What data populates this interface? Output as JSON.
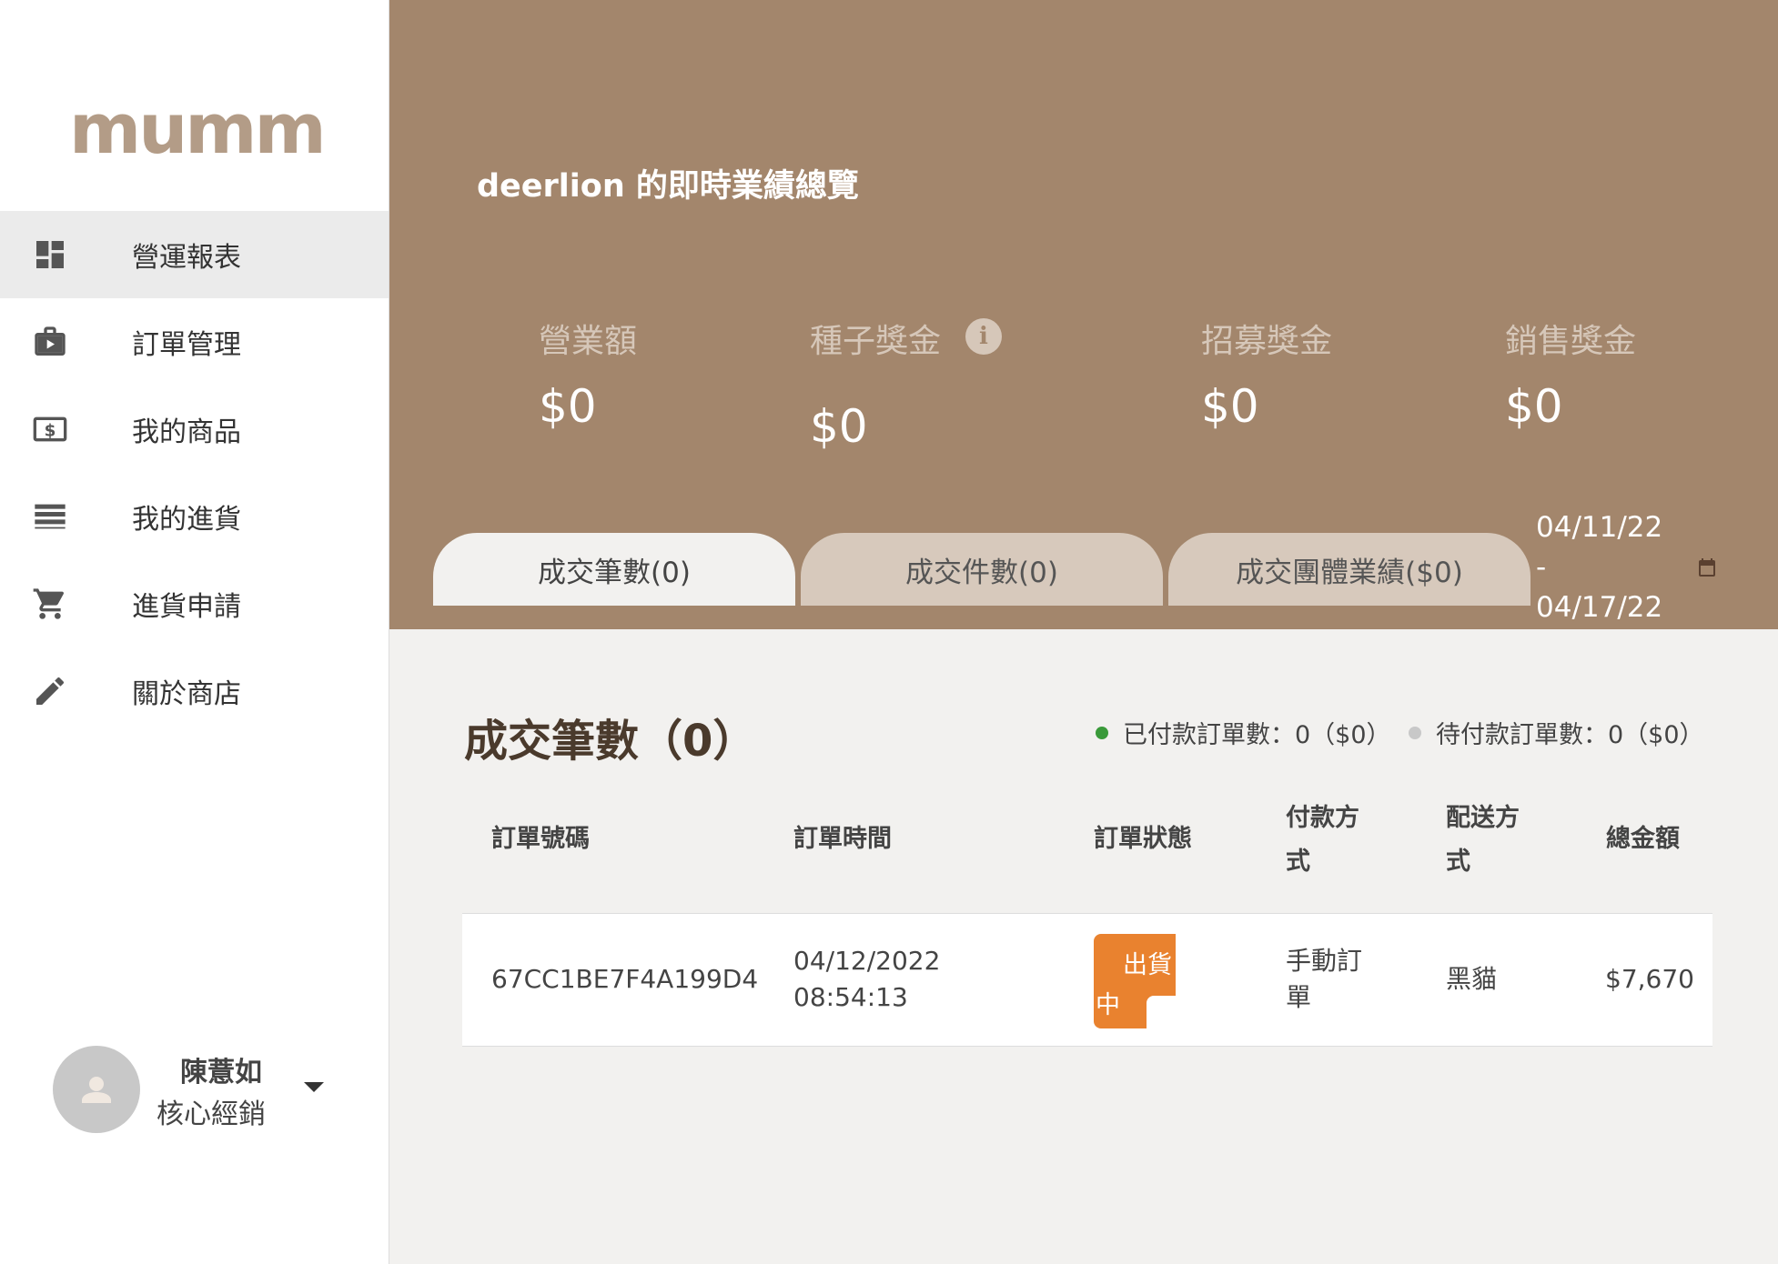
{
  "sidebar": {
    "logo": "mumm",
    "items": [
      {
        "label": "營運報表",
        "icon": "dashboard-icon",
        "active": true
      },
      {
        "label": "訂單管理",
        "icon": "briefcase-play-icon"
      },
      {
        "label": "我的商品",
        "icon": "dollar-bill-icon"
      },
      {
        "label": "我的進貨",
        "icon": "list-icon"
      },
      {
        "label": "進貨申請",
        "icon": "cart-icon"
      },
      {
        "label": "關於商店",
        "icon": "pencil-icon"
      }
    ],
    "user": {
      "name": "陳薏如",
      "role": "核心經銷"
    }
  },
  "banner": {
    "title": "deerlion 的即時業績總覽",
    "stats": [
      {
        "label": "營業額",
        "value": "$0"
      },
      {
        "label": "種子獎金",
        "value": "$0",
        "has_info": true
      },
      {
        "label": "招募獎金",
        "value": "$0"
      },
      {
        "label": "銷售獎金",
        "value": "$0"
      }
    ],
    "tabs": [
      "成交筆數(0)",
      "成交件數(0)",
      "成交團體業績($0)"
    ],
    "date_from": "04/11/22",
    "date_sep": "-",
    "date_to": "04/17/22"
  },
  "content": {
    "title": "成交筆數（0）",
    "legend_paid": "已付款訂單數：0（$0）",
    "legend_pending": "待付款訂單數：0（$0）",
    "legend_paid_color": "#3a9a3a",
    "legend_pending_color": "#c8c8c8"
  },
  "table": {
    "headers": {
      "order_no": "訂單號碼",
      "order_time": "訂單時間",
      "status": "訂單狀態",
      "payment_l1": "付款方",
      "payment_l2": "式",
      "shipping_l1": "配送方",
      "shipping_l2": "式",
      "total": "總金額"
    },
    "rows": [
      {
        "order_no": "67CC1BE7F4A199D4",
        "date": "04/12/2022",
        "time": "08:54:13",
        "status_l1": "出貨",
        "status_l2": "中",
        "payment_l1": "手動訂",
        "payment_l2": "單",
        "shipping": "黑貓",
        "total": "$7,670"
      }
    ]
  },
  "colors": {
    "brand": "#a3866c",
    "status_badge": "#e9822f"
  }
}
